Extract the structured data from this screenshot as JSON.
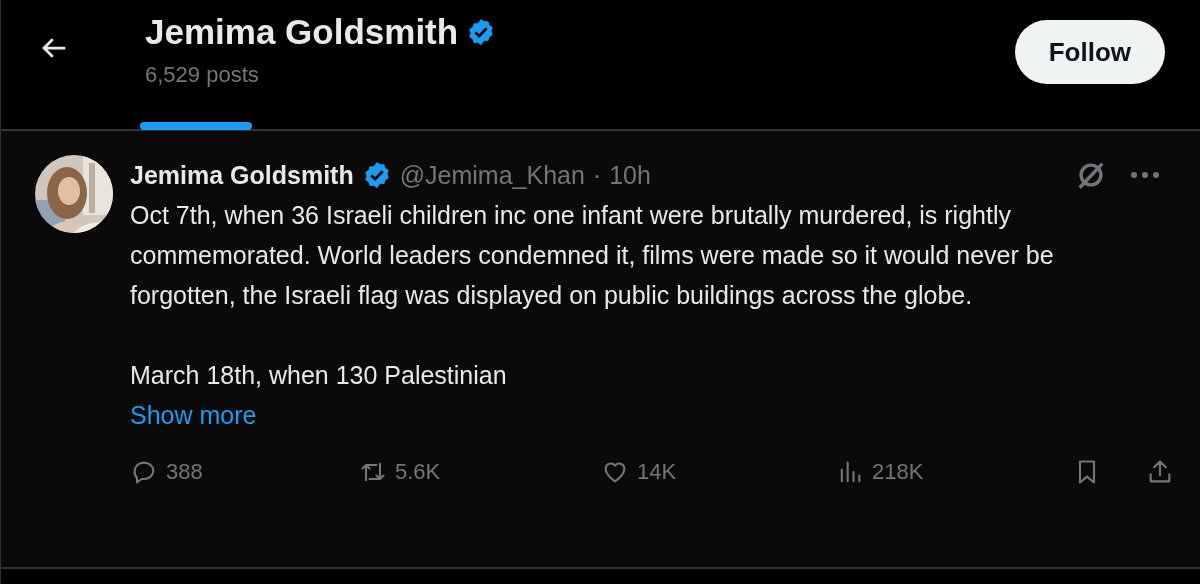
{
  "header": {
    "title": "Jemima Goldsmith",
    "verified": true,
    "subtitle": "6,529 posts",
    "button": "Follow"
  },
  "post": {
    "author": "Jemima Goldsmith",
    "verified": true,
    "handle": "@Jemima_Khan",
    "separator": "·",
    "time": "10h",
    "paragraphs": [
      "Oct 7th, when 36 Israeli children inc one infant were brutally murdered, is rightly commemorated. World leaders condemned it, films were made so it would never be forgotten, the Israeli flag was displayed on public buildings across the globe.",
      "March 18th, when 130 Palestinian"
    ],
    "show_more": "Show more",
    "actions": [
      {
        "kind": "reply",
        "count": "388"
      },
      {
        "kind": "repost",
        "count": "5.6K"
      },
      {
        "kind": "like",
        "count": "14K"
      },
      {
        "kind": "views",
        "count": "218K"
      }
    ]
  }
}
